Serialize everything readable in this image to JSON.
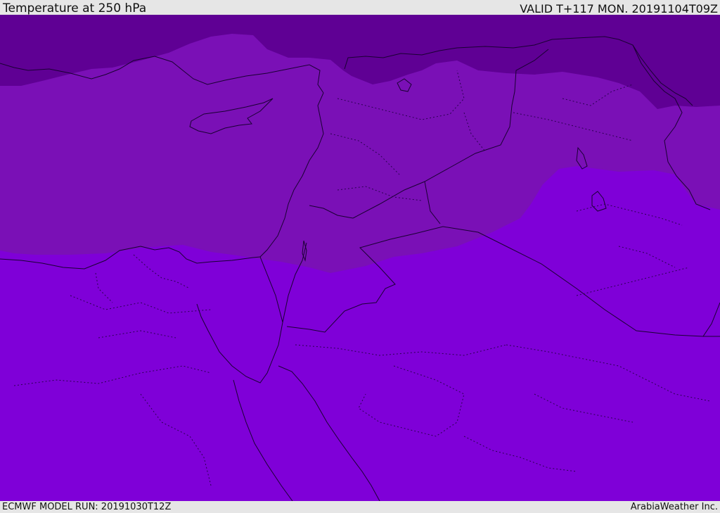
{
  "header": {
    "title": "Temperature at 250 hPa",
    "valid_time": "VALID T+117 MON. 20191104T09Z"
  },
  "footer": {
    "model_run": "ECMWF MODEL RUN: 20191030T12Z",
    "credit": "ArabiaWeather Inc."
  },
  "map": {
    "field": "Temperature at 250 hPa",
    "colors": {
      "coldest_band": "#5f0094",
      "middle_band": "#7a10b6",
      "warmest_band": "#7f00d8",
      "borders": "#1a0033"
    }
  }
}
